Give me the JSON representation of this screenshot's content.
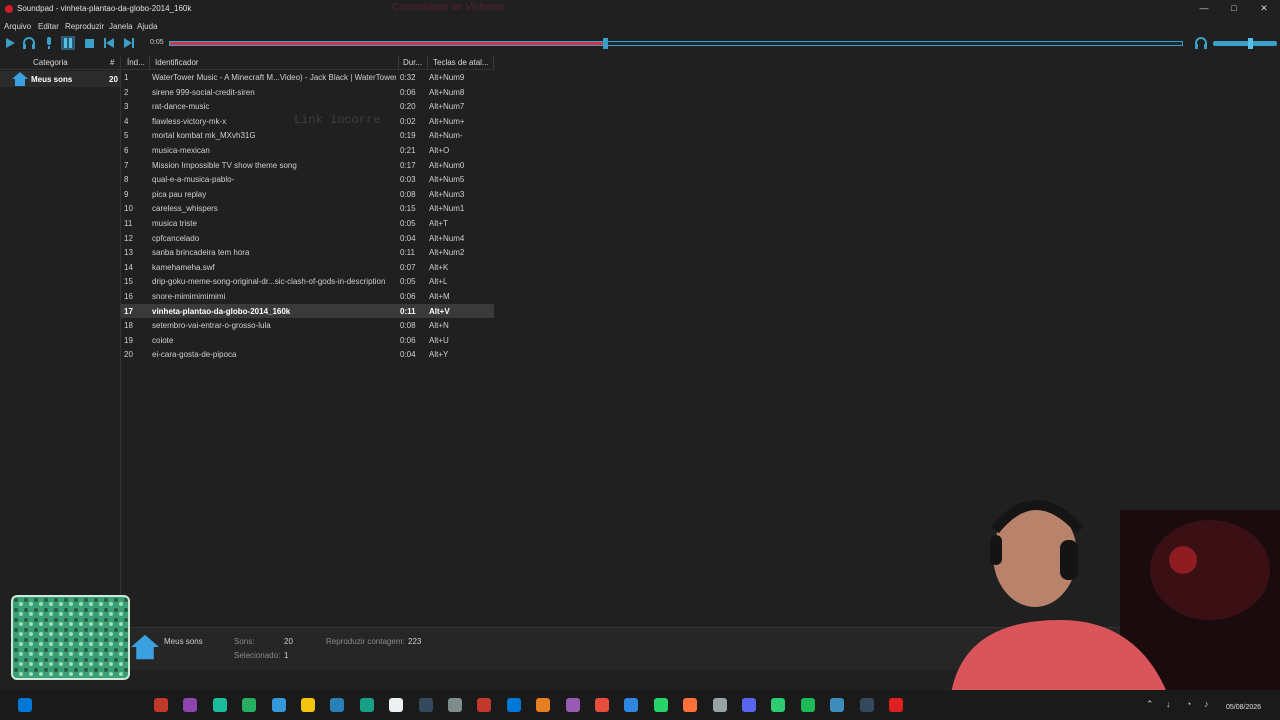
{
  "window": {
    "title": "Soundpad - vinheta-plantao-da-globo-2014_160k",
    "overlay": "Comunidade de Vinhetas"
  },
  "menu": [
    "Arquivo",
    "Editar",
    "Reproduzir",
    "Janela",
    "Ajuda"
  ],
  "player": {
    "time": "0:05",
    "progress_fraction": 0.43,
    "volume_fraction": 0.6
  },
  "sidebar": {
    "col_category": "Categoria",
    "col_count": "#",
    "item_label": "Meus sons",
    "item_count": "20"
  },
  "table": {
    "headers": [
      "Índ...",
      "Identificador",
      "Dur...",
      "Teclas de atal..."
    ],
    "selected_index": 16,
    "rows": [
      {
        "i": "1",
        "name": "WaterTower Music - A Minecraft M...Video) - Jack Black | WaterTower",
        "dur": "0:32",
        "key": "Alt+Num9"
      },
      {
        "i": "2",
        "name": "sirene 999-social-credit-siren",
        "dur": "0:06",
        "key": "Alt+Num8"
      },
      {
        "i": "3",
        "name": "rat-dance-music",
        "dur": "0:20",
        "key": "Alt+Num7"
      },
      {
        "i": "4",
        "name": "flawless-victory-mk-x",
        "dur": "0:02",
        "key": "Alt+Num+"
      },
      {
        "i": "5",
        "name": "mortal kombat mk_MXvh31G",
        "dur": "0:19",
        "key": "Alt+Num-"
      },
      {
        "i": "6",
        "name": "musica-mexican",
        "dur": "0:21",
        "key": "Alt+O"
      },
      {
        "i": "7",
        "name": "Mission Impossible TV show theme song",
        "dur": "0:17",
        "key": "Alt+Num0"
      },
      {
        "i": "8",
        "name": "qual-e-a-musica-pablo-",
        "dur": "0:03",
        "key": "Alt+Num5"
      },
      {
        "i": "9",
        "name": "pica pau replay",
        "dur": "0:08",
        "key": "Alt+Num3"
      },
      {
        "i": "10",
        "name": "careless_whispers",
        "dur": "0:15",
        "key": "Alt+Num1"
      },
      {
        "i": "11",
        "name": "musica triste",
        "dur": "0:05",
        "key": "Alt+T"
      },
      {
        "i": "12",
        "name": "cpfcancelado",
        "dur": "0:04",
        "key": "Alt+Num4"
      },
      {
        "i": "13",
        "name": "sanba brincadeira tem hora",
        "dur": "0:11",
        "key": "Alt+Num2"
      },
      {
        "i": "14",
        "name": "kamehameha.swf",
        "dur": "0:07",
        "key": "Alt+K"
      },
      {
        "i": "15",
        "name": "drip-goku-meme-song-original-dr...sic-clash-of-gods-in-description",
        "dur": "0:05",
        "key": "Alt+L"
      },
      {
        "i": "16",
        "name": "snore-mimimimimimi",
        "dur": "0:06",
        "key": "Alt+M"
      },
      {
        "i": "17",
        "name": "vinheta-plantao-da-globo-2014_160k",
        "dur": "0:11",
        "key": "Alt+V"
      },
      {
        "i": "18",
        "name": "setembro-vai-entrar-o-grosso-lula",
        "dur": "0:08",
        "key": "Alt+N"
      },
      {
        "i": "19",
        "name": "coiote",
        "dur": "0:06",
        "key": "Alt+U"
      },
      {
        "i": "20",
        "name": "ei-cara-gosta-de-pipoca",
        "dur": "0:04",
        "key": "Alt+Y"
      }
    ]
  },
  "ghost_text": "Link incorre",
  "status": {
    "category": "Meus sons",
    "sons_label": "Sons:",
    "sons_value": "20",
    "play_count_label": "Reproduzir contagem:",
    "play_count_value": "223",
    "selected_label": "Selecionado:",
    "selected_value": "1"
  },
  "taskbar": {
    "date": "05/08/2026",
    "icon_colors": [
      "#c0392b",
      "#8e44ad",
      "#1abc9c",
      "#27ae60",
      "#3498db",
      "#f1c40f",
      "#2980b9",
      "#16a085",
      "#ecf0f1",
      "#34495e",
      "#7f8c8d",
      "#c0392b",
      "#0078d7",
      "#e67e22",
      "#9b59b6",
      "#e74c3c",
      "#2e86de",
      "#25d366",
      "#ff7139",
      "#95a5a6",
      "#5865f2",
      "#2ecc71",
      "#1db954",
      "#3c8dbc",
      "#34495e",
      "#e02020"
    ]
  }
}
